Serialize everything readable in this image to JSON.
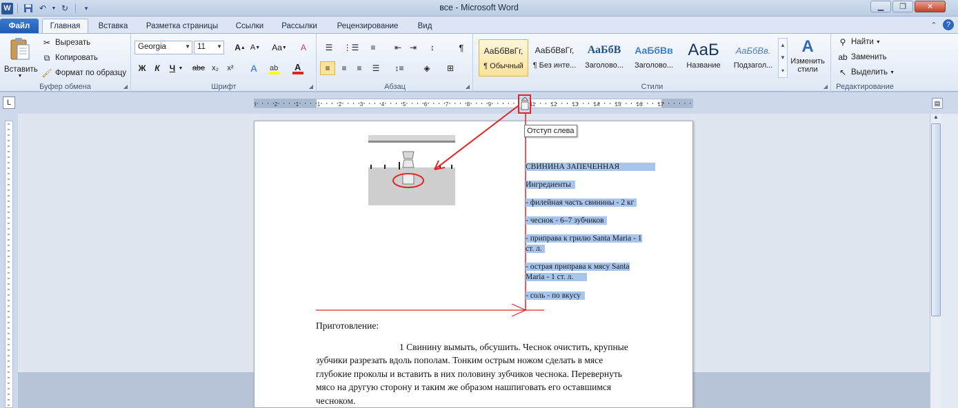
{
  "window": {
    "title": "все  -  Microsoft Word",
    "word_logo": "W",
    "qat_icons": [
      "save-icon",
      "undo-icon",
      "redo-icon",
      "customize-icon"
    ],
    "controls": [
      "minimize",
      "restore",
      "close"
    ]
  },
  "tabs": {
    "file": "Файл",
    "home": "Главная",
    "insert": "Вставка",
    "layout": "Разметка страницы",
    "references": "Ссылки",
    "mailings": "Рассылки",
    "review": "Рецензирование",
    "view": "Вид"
  },
  "clipboard": {
    "paste": "Вставить",
    "cut": "Вырезать",
    "copy": "Копировать",
    "format_painter": "Формат по образцу",
    "label": "Буфер обмена"
  },
  "font": {
    "name": "Georgia",
    "size": "11",
    "label": "Шрифт",
    "bold": "Ж",
    "italic": "К",
    "underline": "Ч",
    "strike": "abe",
    "sub": "x₂",
    "sup": "x²",
    "grow": "A",
    "shrink": "A",
    "case": "Aa",
    "clear": "A"
  },
  "paragraph": {
    "label": "Абзац"
  },
  "styles": {
    "label": "Стили",
    "items": [
      {
        "preview": "АаБбВвГг,",
        "name": "¶ Обычный"
      },
      {
        "preview": "АаБбВвГг,",
        "name": "¶ Без инте..."
      },
      {
        "preview": "АаБбВ",
        "name": "Заголово..."
      },
      {
        "preview": "АаБбВв",
        "name": "Заголово..."
      },
      {
        "preview": "АаБ",
        "name": "Название"
      },
      {
        "preview": "АаБбВв.",
        "name": "Подзагол..."
      }
    ],
    "change": "Изменить стили"
  },
  "editing": {
    "label": "Редактирование",
    "find": "Найти",
    "replace": "Заменить",
    "select": "Выделить"
  },
  "ruler": {
    "numbers": [
      "3",
      "2",
      "1",
      "1",
      "2",
      "3",
      "4",
      "5",
      "6",
      "7",
      "8",
      "9",
      "11",
      "12",
      "13",
      "14",
      "15",
      "16",
      "17"
    ],
    "tab_selector": "L"
  },
  "tooltip": "Отступ слева",
  "selected_text": [
    "СВИНИНА ЗАПЕЧЕННАЯ",
    "Ингредиенты",
    "- филейная часть свинины - 2 кг",
    "- чеснок - 6–7 зубчиков",
    "- приправа к грилю Santa Maria - 1",
    "ст. л.",
    "- острая приправа к мясу Santa",
    "Maria - 1 ст. л.",
    "- соль - по вкусу"
  ],
  "body_text": {
    "heading": "Приготовление:",
    "lines": [
      "1 Свинину вымыть, обсушить. Чеснок очистить, крупные",
      "зубчики разрезать вдоль пополам. Тонким острым ножом сделать в мясе",
      "глубокие проколы и вставить в них половину зубчиков чеснока. Перевернуть",
      "мясо на другую сторону и таким же образом нашпиговать его оставшимся",
      "чесноком."
    ]
  },
  "annotation_color": "#e32424",
  "selection_color": "#a7c5ec"
}
